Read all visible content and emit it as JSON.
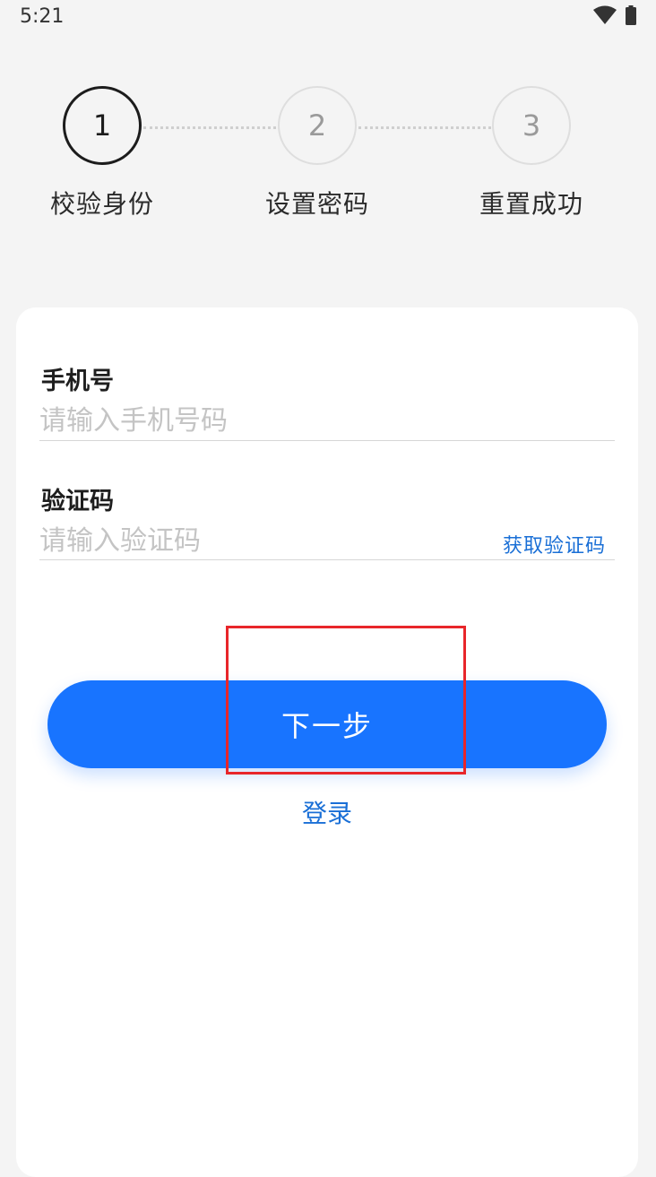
{
  "status_bar": {
    "time": "5:21",
    "icons": [
      "wifi-icon",
      "battery-icon"
    ]
  },
  "stepper": {
    "steps": [
      {
        "number": "1",
        "label": "校验身份",
        "state": "active"
      },
      {
        "number": "2",
        "label": "设置密码",
        "state": "inactive"
      },
      {
        "number": "3",
        "label": "重置成功",
        "state": "inactive"
      }
    ]
  },
  "form": {
    "phone": {
      "label": "手机号",
      "placeholder": "请输入手机号码",
      "value": ""
    },
    "code": {
      "label": "验证码",
      "placeholder": "请输入验证码",
      "value": "",
      "get_code_label": "获取验证码"
    },
    "next_label": "下一步",
    "login_label": "登录"
  },
  "colors": {
    "accent": "#1874ff",
    "link": "#1a6fd6",
    "highlight": "#e8262a",
    "background": "#f4f4f4"
  }
}
